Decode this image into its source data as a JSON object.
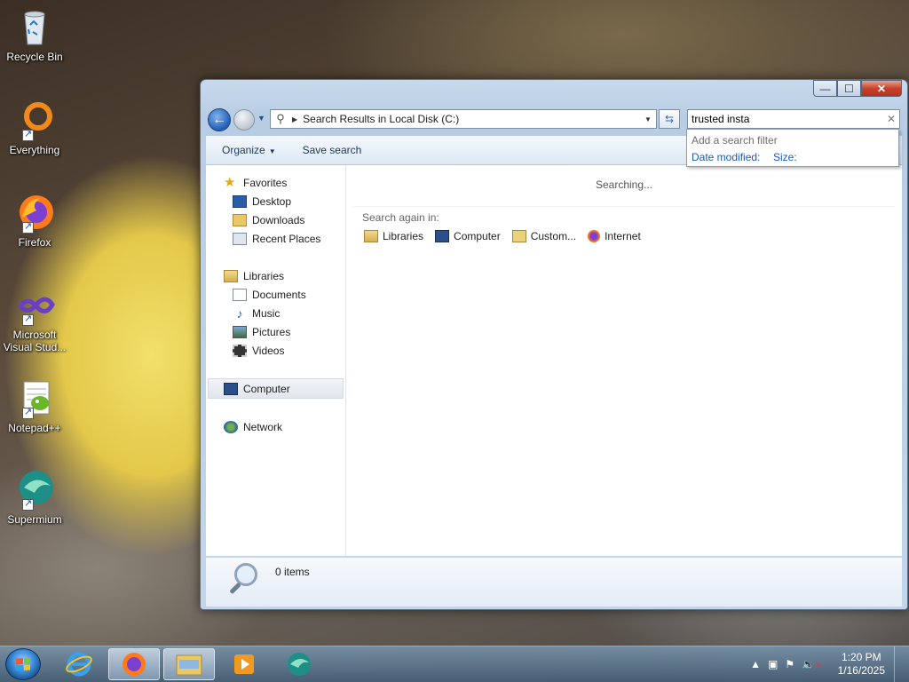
{
  "desktop": {
    "icons": [
      {
        "label": "Recycle Bin"
      },
      {
        "label": "Everything"
      },
      {
        "label": "Firefox"
      },
      {
        "label": "Microsoft Visual Stud..."
      },
      {
        "label": "Notepad++"
      },
      {
        "label": "Supermium"
      }
    ]
  },
  "window": {
    "controls": {
      "minimize": "—",
      "maximize": "☐",
      "close": "✕"
    },
    "address": "Search Results in Local Disk (C:)",
    "search": {
      "value": "trusted insta"
    },
    "toolbar": {
      "organize": "Organize",
      "save_search": "Save search"
    },
    "filter_popup": {
      "hint": "Add a search filter",
      "options": [
        "Date modified:",
        "Size:"
      ]
    },
    "navpane": {
      "favorites": "Favorites",
      "favorites_items": [
        "Desktop",
        "Downloads",
        "Recent Places"
      ],
      "libraries": "Libraries",
      "libraries_items": [
        "Documents",
        "Music",
        "Pictures",
        "Videos"
      ],
      "computer": "Computer",
      "network": "Network"
    },
    "main": {
      "status": "Searching...",
      "search_again_label": "Search again in:",
      "locations": [
        "Libraries",
        "Computer",
        "Custom...",
        "Internet"
      ]
    },
    "statusbar": {
      "items": "0 items"
    }
  },
  "taskbar": {
    "clock": {
      "time": "1:20 PM",
      "date": "1/16/2025"
    }
  }
}
